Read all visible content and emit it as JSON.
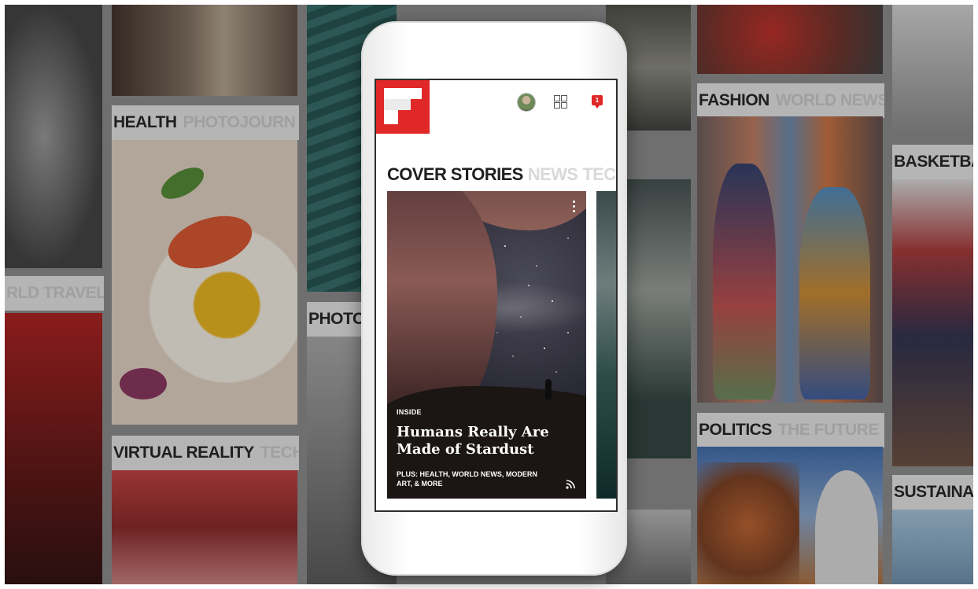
{
  "background": {
    "labels": {
      "health": {
        "strong": "HEALTH",
        "faint": "PHOTOJOURN"
      },
      "virtual_reality": {
        "strong": "VIRTUAL REALITY",
        "faint": "TECH"
      },
      "world_travel": {
        "strong": "",
        "faint": "RLD TRAVEL"
      },
      "photo": {
        "strong": "PHOTO",
        "faint": ""
      },
      "fashion": {
        "strong": "FASHION",
        "faint": "WORLD NEWS"
      },
      "politics": {
        "strong": "POLITICS",
        "faint": "THE FUTURE"
      },
      "basketball": {
        "strong": "BASKETBAL",
        "faint": ""
      },
      "sustainable": {
        "strong": "SUSTAINAB",
        "faint": ""
      }
    }
  },
  "app": {
    "brand": "Flipboard",
    "sections": {
      "active": "COVER STORIES",
      "others": [
        "NEWS",
        "TECH"
      ]
    },
    "notification_count": "1",
    "card": {
      "kicker": "INSIDE",
      "title": "Humans Really Are Made of Stardust",
      "plus": "PLUS: HEALTH, WORLD NEWS, MODERN ART, & MORE"
    }
  },
  "colors": {
    "brand_red": "#e12828"
  }
}
